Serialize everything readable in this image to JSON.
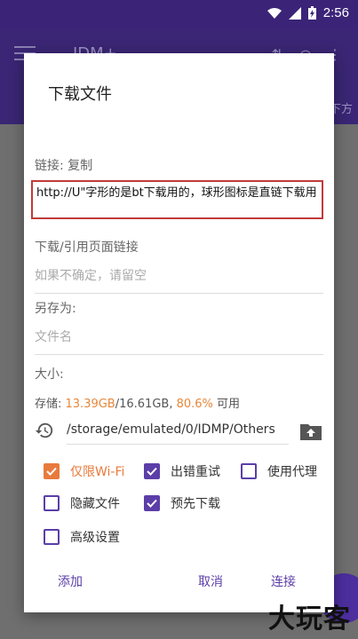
{
  "status": {
    "time": "2:56"
  },
  "app": {
    "title": "IDM+",
    "subtitle_partial": "下方"
  },
  "dialog": {
    "title": "下载文件",
    "link_label": "链接: 复制",
    "url_value": "http://U\"字形的是bt下载用的，球形图标是直链下载用",
    "referer": {
      "label": "下载/引用页面链接",
      "placeholder": "如果不确定，请留空"
    },
    "save_as": {
      "label": "另存为:",
      "placeholder": "文件名"
    },
    "size_label": "大小:",
    "storage": {
      "prefix": "存储: ",
      "used": "13.39GB",
      "total": "/16.61GB, ",
      "percent": "80.6%",
      "suffix": " 可用"
    },
    "path": "/storage/emulated/0/IDMP/Others",
    "options": [
      {
        "label": "仅限Wi-Fi",
        "checked": true,
        "highlight": true
      },
      {
        "label": "出错重试",
        "checked": true
      },
      {
        "label": "使用代理",
        "checked": false
      },
      {
        "label": "隐藏文件",
        "checked": false
      },
      {
        "label": "预先下载",
        "checked": true
      },
      {
        "label": "高级设置",
        "checked": false
      }
    ],
    "buttons": {
      "add": "添加",
      "cancel": "取消",
      "connect": "连接"
    }
  },
  "watermark": "大玩客",
  "colors": {
    "primary": "#5b3ea8",
    "accent": "#e87a3d",
    "appbar": "#3a2674",
    "highlight_border": "#c23a3a"
  }
}
